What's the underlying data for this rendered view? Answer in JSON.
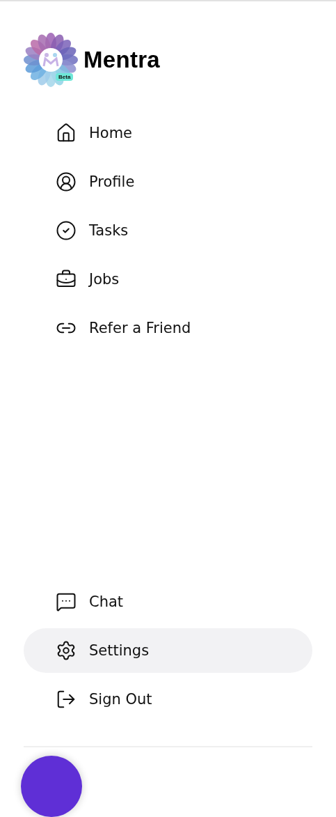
{
  "brand": {
    "name": "Mentra",
    "badge": "Beta"
  },
  "nav_items": [
    {
      "label": "Home",
      "selected": false
    },
    {
      "label": "Profile",
      "selected": false
    },
    {
      "label": "Tasks",
      "selected": false
    },
    {
      "label": "Jobs",
      "selected": false
    },
    {
      "label": "Refer a Friend",
      "selected": false
    }
  ],
  "bottom_items": [
    {
      "label": "Chat",
      "selected": false
    },
    {
      "label": "Settings",
      "selected": true
    },
    {
      "label": "Sign Out",
      "selected": false
    }
  ]
}
